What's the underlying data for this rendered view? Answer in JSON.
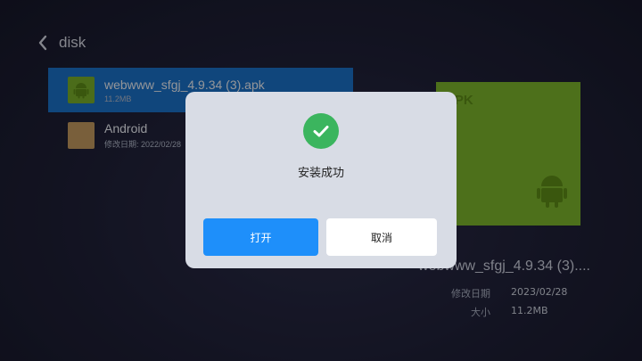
{
  "header": {
    "title": "disk",
    "back_icon": "chevron-left-icon"
  },
  "files": [
    {
      "name": "webwww_sfgj_4.9.34 (3).apk",
      "meta": "11.2MB",
      "icon": "android-icon",
      "selected": true
    },
    {
      "name": "Android",
      "meta": "修改日期: 2022/02/28",
      "icon": "folder-icon",
      "selected": false
    }
  ],
  "preview": {
    "type_label": "APK",
    "name": "webwww_sfgj_4.9.34 (3)....",
    "modified_label": "修改日期",
    "modified_value": "2023/02/28",
    "size_label": "大小",
    "size_value": "11.2MB",
    "card_color": "#7cb52c"
  },
  "dialog": {
    "icon": "check-circle-icon",
    "message": "安装成功",
    "open_label": "打开",
    "cancel_label": "取消",
    "accent": "#1e8ffa",
    "success_color": "#3bb55e"
  }
}
